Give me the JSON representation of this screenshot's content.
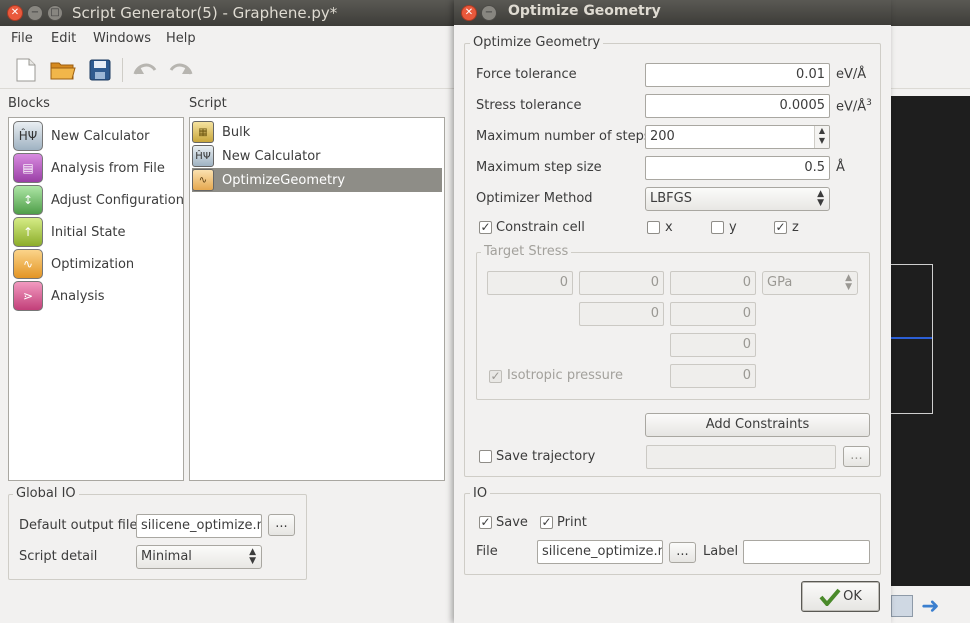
{
  "window": {
    "title": "Script Generator(5) - Graphene.py*"
  },
  "menubar": [
    "File",
    "Edit",
    "Windows",
    "Help"
  ],
  "toolbar": {
    "icons": [
      "new-file-icon",
      "open-folder-icon",
      "save-icon",
      "undo-icon",
      "redo-icon"
    ]
  },
  "blocks": {
    "label": "Blocks",
    "items": [
      {
        "label": "New Calculator",
        "glyph": "ĤΨ"
      },
      {
        "label": "Analysis from File",
        "glyph": "▤"
      },
      {
        "label": "Adjust Configuration",
        "glyph": "↕"
      },
      {
        "label": "Initial State",
        "glyph": "↑"
      },
      {
        "label": "Optimization",
        "glyph": "∿"
      },
      {
        "label": "Analysis",
        "glyph": "⋗"
      }
    ]
  },
  "script": {
    "label": "Script",
    "items": [
      {
        "label": "Bulk",
        "glyph": "▦"
      },
      {
        "label": "New Calculator",
        "glyph": "ĤΨ"
      },
      {
        "label": "OptimizeGeometry",
        "glyph": "∿"
      }
    ]
  },
  "global_io": {
    "title": "Global IO",
    "output_label": "Default output file",
    "output_value": "silicene_optimize.nc",
    "browse": "...",
    "detail_label": "Script detail",
    "detail_value": "Minimal"
  },
  "dialog": {
    "title": "Optimize Geometry",
    "group_title": "Optimize Geometry",
    "force_label": "Force tolerance",
    "force_value": "0.01",
    "force_unit": "eV/Å",
    "stress_label": "Stress tolerance",
    "stress_value": "0.0005",
    "stress_unit": "eV/Å",
    "stress_unit_sup": "3",
    "steps_label": "Maximum number of steps",
    "steps_value": "200",
    "stepsize_label": "Maximum step size",
    "stepsize_value": "0.5",
    "stepsize_unit": "Å",
    "method_label": "Optimizer Method",
    "method_value": "LBFGS",
    "constrain_label": "Constrain cell",
    "x": "x",
    "y": "y",
    "z": "z",
    "target_stress": {
      "title": "Target Stress",
      "values": [
        "0",
        "0",
        "0",
        "0",
        "0",
        "0",
        "0"
      ],
      "unit": "GPa",
      "isotropic_label": "Isotropic pressure"
    },
    "add_constraints": "Add Constraints",
    "save_traj_label": "Save trajectory",
    "traj_browse": "...",
    "io": {
      "title": "IO",
      "save": "Save",
      "print": "Print",
      "file_label": "File",
      "file_value": "silicene_optimize.nc",
      "browse": "...",
      "label_label": "Label",
      "label_value": ""
    },
    "ok": "OK"
  },
  "colors": {
    "titlebar": "#3d3c38",
    "close": "#e9593c",
    "selection": "#8e8d87",
    "arrow": "#3b7fcf"
  }
}
